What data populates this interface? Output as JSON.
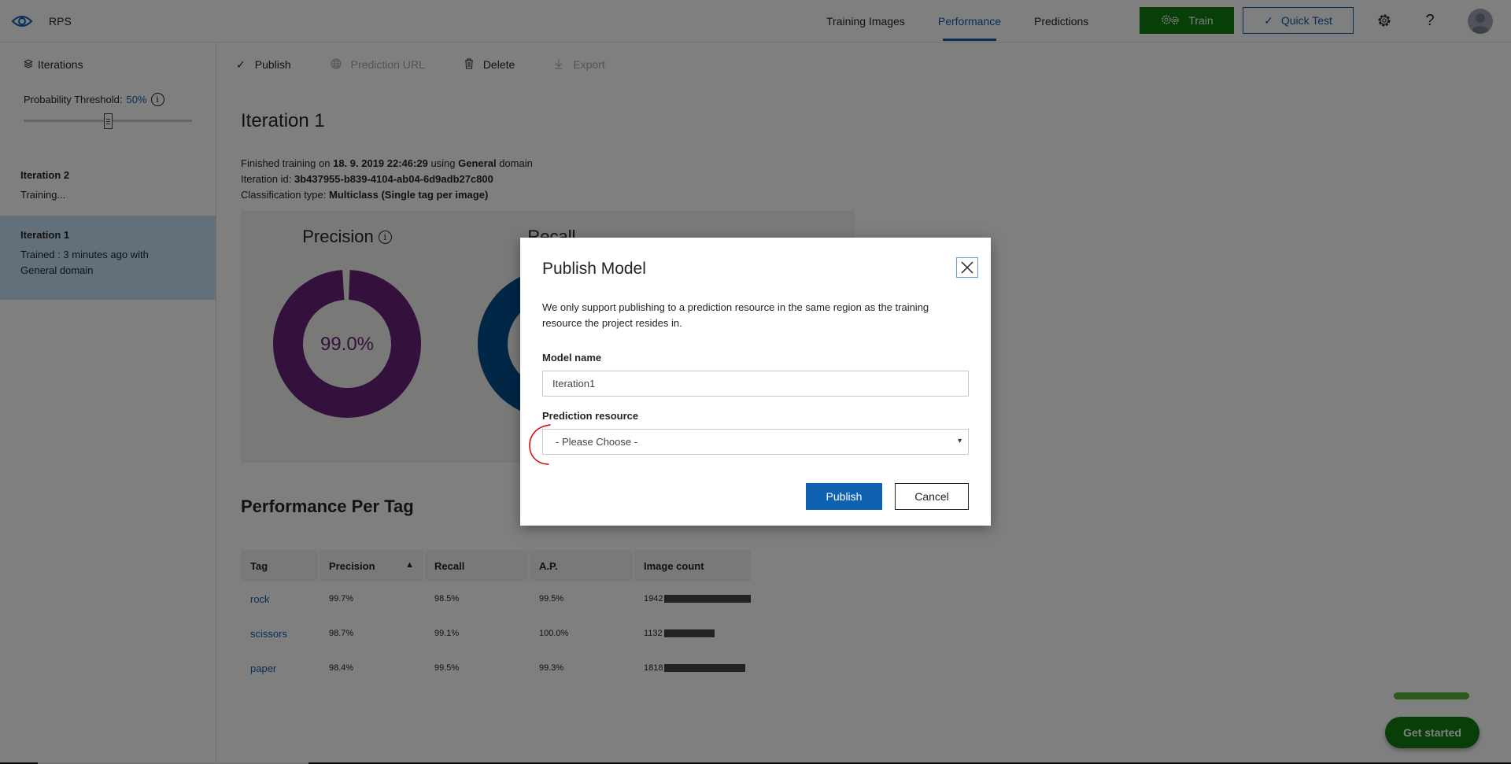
{
  "app": {
    "project_name": "RPS",
    "colors": {
      "accent": "#0f5cab",
      "train_green": "#107c10",
      "precision": "#68217a",
      "recall": "#004e8c",
      "selected_row": "#c6e0f5"
    }
  },
  "header": {
    "nav": [
      {
        "label": "Training Images",
        "active": false
      },
      {
        "label": "Performance",
        "active": true
      },
      {
        "label": "Predictions",
        "active": false
      }
    ],
    "train_label": "Train",
    "quick_test_label": "Quick Test",
    "help_glyph": "?"
  },
  "sidebar": {
    "heading": "Iterations",
    "threshold_label": "Probability Threshold:",
    "threshold_value": "50%",
    "threshold_fraction": 0.5,
    "iterations": [
      {
        "title": "Iteration 2",
        "status": "Training...",
        "selected": false
      },
      {
        "title": "Iteration 1",
        "status": "Trained : 3 minutes ago with General domain",
        "selected": true
      }
    ]
  },
  "toolbar": {
    "items": [
      {
        "label": "Publish",
        "icon": "check-icon",
        "enabled": true
      },
      {
        "label": "Prediction URL",
        "icon": "globe-icon",
        "enabled": false
      },
      {
        "label": "Delete",
        "icon": "trash-icon",
        "enabled": true
      },
      {
        "label": "Export",
        "icon": "download-icon",
        "enabled": false
      }
    ]
  },
  "main": {
    "title": "Iteration 1",
    "meta": {
      "finished_prefix": "Finished training on",
      "finished_date": "18. 9. 2019 22:46:29",
      "using": "using",
      "domain": "General",
      "domain_suffix": "domain",
      "iteration_id_label": "Iteration id:",
      "iteration_id": "3b437955-b839-4104-ab04-6d9adb27c800",
      "classification_label": "Classification type:",
      "classification": "Multiclass (Single tag per image)"
    },
    "metrics": [
      {
        "title": "Precision",
        "value": "99.0%",
        "fraction": 0.99
      },
      {
        "title": "Recall",
        "value": "",
        "fraction": 0.99
      }
    ],
    "per_tag_title": "Performance Per Tag",
    "table": {
      "headers": [
        "Tag",
        "Precision",
        "Recall",
        "A.P.",
        "Image count"
      ],
      "rows": [
        {
          "tag": "rock",
          "precision": "99.7%",
          "recall": "98.5%",
          "ap": "99.5%",
          "count": "1942",
          "count_value": 1942
        },
        {
          "tag": "scissors",
          "precision": "98.7%",
          "recall": "99.1%",
          "ap": "100.0%",
          "count": "1132",
          "count_value": 1132
        },
        {
          "tag": "paper",
          "precision": "98.4%",
          "recall": "99.5%",
          "ap": "99.3%",
          "count": "1818",
          "count_value": 1818
        }
      ]
    }
  },
  "get_started": {
    "label": "Get started"
  },
  "modal": {
    "title": "Publish Model",
    "description": "We only support publishing to a prediction resource in the same region as the training resource the project resides in.",
    "model_name_label": "Model name",
    "model_name_value": "Iteration1",
    "prediction_resource_label": "Prediction resource",
    "prediction_resource_value": "- Please Choose -",
    "publish_label": "Publish",
    "cancel_label": "Cancel"
  }
}
